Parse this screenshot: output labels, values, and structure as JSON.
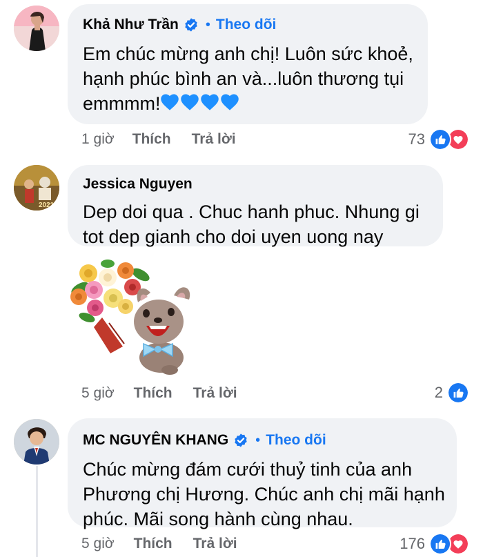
{
  "comments": [
    {
      "name": "Khả Như Trần",
      "verified": true,
      "follow_label": "Theo dõi",
      "text_lines": [
        "Em chúc mừng anh chị! Luôn sức khoẻ,",
        "hạnh phúc bình an và...luôn thương tụi",
        "emmmm!"
      ],
      "emoji": "💙💙💙💙",
      "time": "1 giờ",
      "like_label": "Thích",
      "reply_label": "Trả lời",
      "reaction_count": "73",
      "reactions": [
        "like-icon",
        "love-icon"
      ]
    },
    {
      "name": "Jessica Nguyen",
      "avatar_text": "2021",
      "text_lines": [
        "Dep doi  qua . Chuc hanh phuc. Nhung gi",
        "tot dep gianh cho doi uyen uong nay"
      ],
      "sticker": "flower-bouquet-dog-sticker",
      "time": "5 giờ",
      "like_label": "Thích",
      "reply_label": "Trả lời",
      "reaction_count": "2",
      "reactions": [
        "like-icon"
      ]
    },
    {
      "name": "MC NGUYÊN KHANG",
      "verified": true,
      "follow_label": "Theo dõi",
      "text_lines": [
        "Chúc mừng đám cưới thuỷ tinh của anh",
        "Phương chị Hương. Chúc anh chị mãi hạnh",
        "phúc. Mãi song hành cùng nhau."
      ],
      "time": "5 giờ",
      "like_label": "Thích",
      "reply_label": "Trả lời",
      "reaction_count": "176",
      "reactions": [
        "like-icon",
        "love-icon"
      ]
    }
  ],
  "colors": {
    "bubble": "#f0f2f5",
    "link_blue": "#1877f2",
    "meta_gray": "#65676b",
    "love_red": "#f33e58"
  }
}
